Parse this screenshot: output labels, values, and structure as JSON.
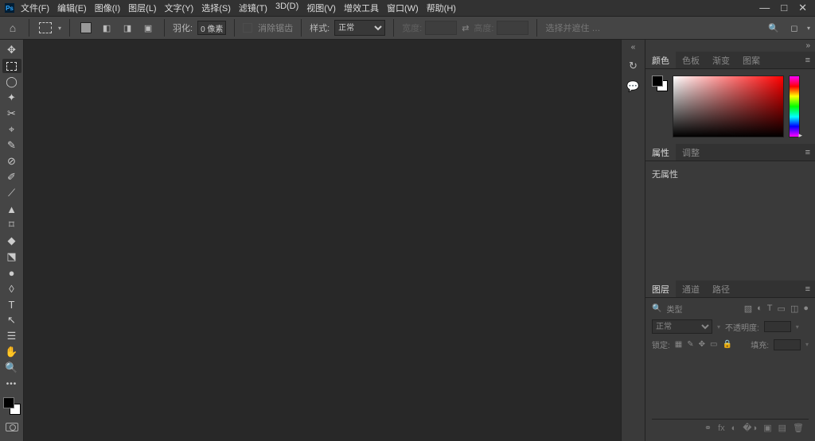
{
  "menu": [
    "文件(F)",
    "编辑(E)",
    "图像(I)",
    "图层(L)",
    "文字(Y)",
    "选择(S)",
    "滤镜(T)",
    "3D(D)",
    "视图(V)",
    "增效工具",
    "窗口(W)",
    "帮助(H)"
  ],
  "optbar": {
    "feather_label": "羽化:",
    "feather_value": "0 像素",
    "antialias": "消除锯齿",
    "style_label": "样式:",
    "style_value": "正常",
    "width_label": "宽度:",
    "height_label": "高度:",
    "select_mask": "选择并遮住 …"
  },
  "tools": [
    "✥",
    "▭",
    "◯",
    "✦",
    "✂",
    "⌖",
    "✎",
    "⊘",
    "✐",
    "⟋",
    "▲",
    "⌑",
    "◆",
    "⬔",
    "●",
    "◊",
    "✎",
    "T",
    "↖",
    "☰",
    "✋",
    "🔍"
  ],
  "panels": {
    "color_tabs": [
      "颜色",
      "色板",
      "渐变",
      "图案"
    ],
    "props_tabs": [
      "属性",
      "调整"
    ],
    "props_empty": "无属性",
    "layers_tabs": [
      "图层",
      "通道",
      "路径"
    ],
    "layers_kind": "类型",
    "layers_mode": "正常",
    "layers_opacity_label": "不透明度:",
    "layers_lock_label": "锁定:",
    "layers_fill_label": "填充:"
  }
}
